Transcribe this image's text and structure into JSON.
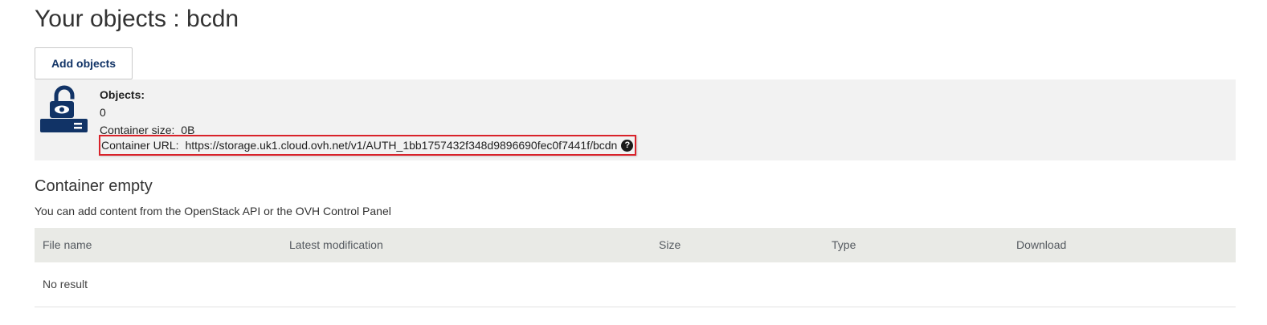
{
  "header": {
    "title": "Your objects : bcdn"
  },
  "toolbar": {
    "add_label": "Add objects"
  },
  "container": {
    "icon": "unlocked-container-icon",
    "objects_label": "Objects:",
    "objects_value": "0",
    "size_label": "Container size:",
    "size_value": "0B",
    "url_label": "Container URL:",
    "url_value": "https://storage.uk1.cloud.ovh.net/v1/AUTH_1bb1757432f348d9896690fec0f7441f/bcdn",
    "help_glyph": "?",
    "highlight_color": "#d9222a"
  },
  "empty_state": {
    "title": "Container empty",
    "description": "You can add content from the OpenStack API or the OVH Control Panel"
  },
  "table": {
    "columns": [
      "File name",
      "Latest modification",
      "Size",
      "Type",
      "Download"
    ],
    "empty_text": "No result"
  },
  "colors": {
    "brand": "#113366",
    "panel_bg": "#f2f2f2",
    "table_head_bg": "#e9eae6"
  }
}
